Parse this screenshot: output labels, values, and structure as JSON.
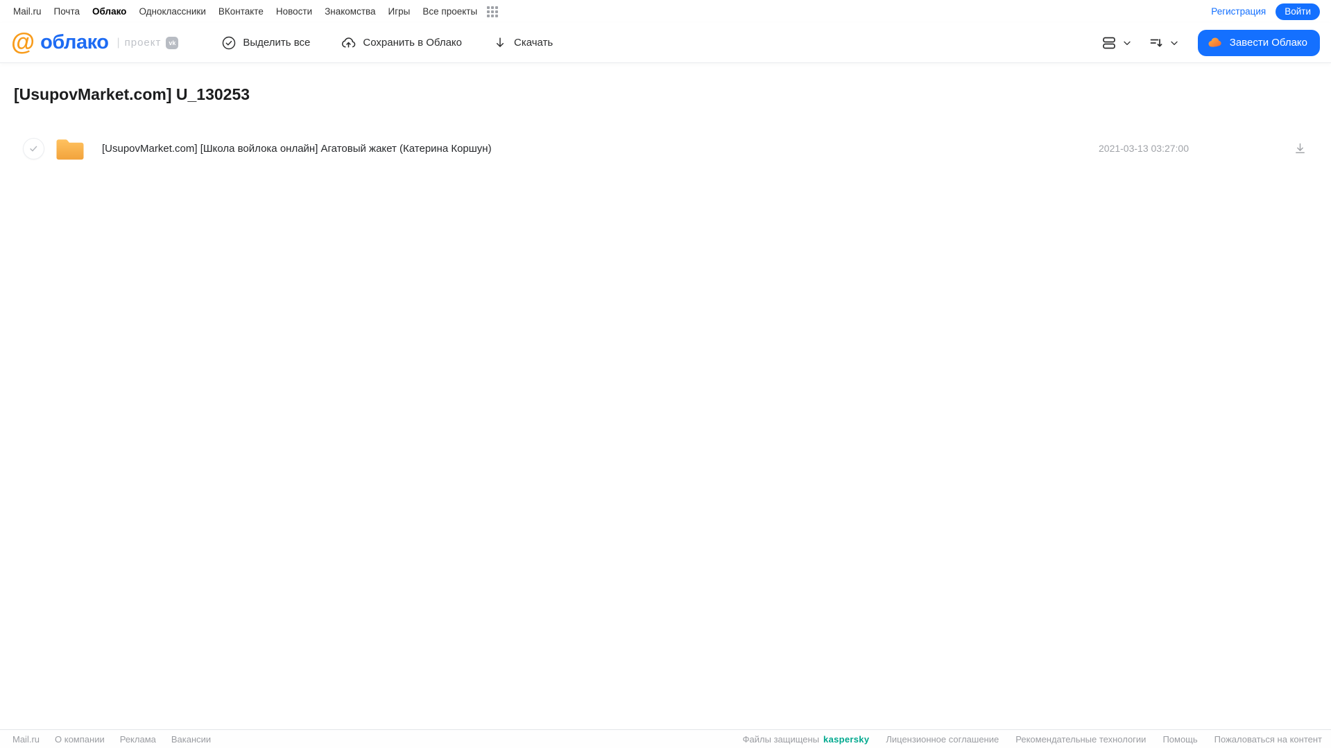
{
  "top_nav": {
    "links": [
      "Mail.ru",
      "Почта",
      "Облако",
      "Одноклассники",
      "ВКонтакте",
      "Новости",
      "Знакомства",
      "Игры",
      "Все проекты"
    ],
    "active_link": "Облако",
    "registration_label": "Регистрация",
    "login_label": "Войти"
  },
  "header": {
    "logo_at": "@",
    "logo_word": "облако",
    "project_divider": "|",
    "project_label": "проект",
    "vk_badge": "vk",
    "toolbar": {
      "select_all_label": "Выделить все",
      "save_to_cloud_label": "Сохранить в Облако",
      "download_label": "Скачать"
    },
    "get_cloud_label": "Завести Облако"
  },
  "page": {
    "title": "[UsupovMarket.com] U_130253"
  },
  "files": [
    {
      "name": "[UsupovMarket.com] [Школа войлока онлайн] Агатовый жакет (Катерина Коршун)",
      "date": "2021-03-13 03:27:00"
    }
  ],
  "footer": {
    "left_links": [
      "Mail.ru",
      "О компании",
      "Реклама",
      "Вакансии"
    ],
    "protected_label": "Файлы защищены",
    "kaspersky_label": "kaspersky",
    "right_links": [
      "Лицензионное соглашение",
      "Рекомендательные технологии",
      "Помощь",
      "Пожаловаться на контент"
    ]
  },
  "colors": {
    "accent_blue": "#1470ff",
    "logo_blue": "#1d6bf3",
    "logo_orange": "#f89c1c",
    "folder_amber_top": "#ffc260",
    "folder_amber_bottom": "#f2a33c",
    "kaspersky_green": "#00a88e",
    "muted_gray": "#9a9ca1"
  }
}
